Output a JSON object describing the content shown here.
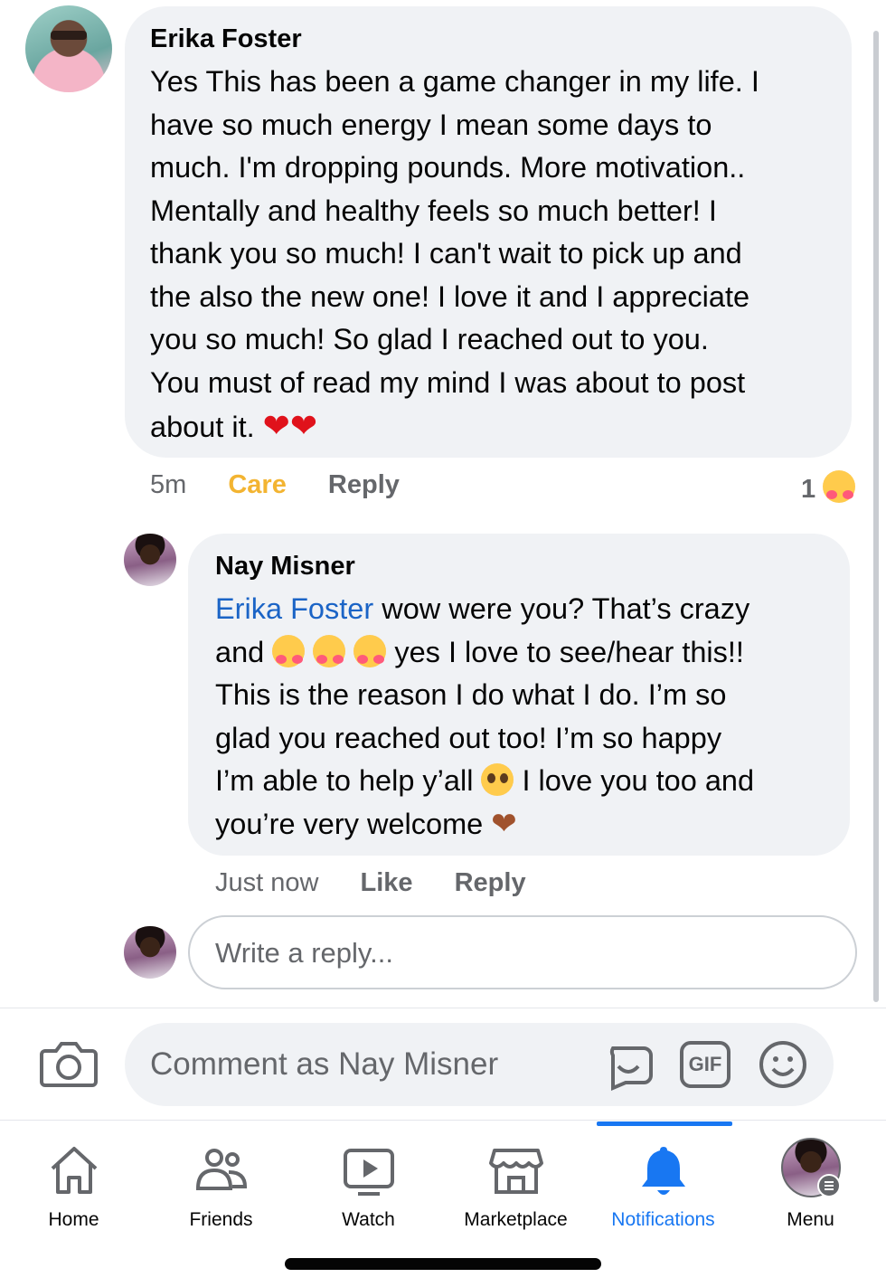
{
  "comment1": {
    "author": "Erika Foster",
    "lines": [
      "Yes This has been a game changer in my life. I",
      "have so much energy I mean some days to",
      "much. I'm dropping pounds. More motivation..",
      "Mentally and healthy feels so much better! I",
      "thank you so much! I can't wait to pick up and",
      "the also the new one! I love it and I appreciate",
      "you so much! So glad I reached out to you.",
      "You must of read my mind I was about to post"
    ],
    "last_line": "about it.",
    "hearts": "❤❤",
    "timestamp": "5m",
    "reaction_label": "Care",
    "reply_label": "Reply",
    "reaction_count": "1"
  },
  "comment2": {
    "author": "Nay Misner",
    "mention": "Erika Foster",
    "line1_rest": " wow were you? That’s crazy",
    "line2_a": "and",
    "line2_b": "yes I love to see/hear this!!",
    "line3": "This is the reason I do what I do. I’m so",
    "line4": "glad you reached out too! I’m so happy",
    "line5_a": "I’m able to help y’all",
    "line5_b": "I love you too and",
    "line6": "you’re very welcome",
    "timestamp": "Just now",
    "like_label": "Like",
    "reply_label": "Reply"
  },
  "reply_box": {
    "placeholder": "Write a reply..."
  },
  "comment_bar": {
    "placeholder": "Comment as Nay Misner",
    "gif_label": "GIF"
  },
  "tabs": [
    {
      "label": "Home",
      "icon": "home-icon"
    },
    {
      "label": "Friends",
      "icon": "friends-icon"
    },
    {
      "label": "Watch",
      "icon": "watch-icon"
    },
    {
      "label": "Marketplace",
      "icon": "marketplace-icon"
    },
    {
      "label": "Notifications",
      "icon": "bell-icon",
      "active": true
    },
    {
      "label": "Menu",
      "icon": "menu-avatar"
    }
  ],
  "colors": {
    "accent": "#1877f2",
    "care": "#f3b431",
    "mention": "#1b64c6",
    "bubble": "#f0f2f5"
  }
}
